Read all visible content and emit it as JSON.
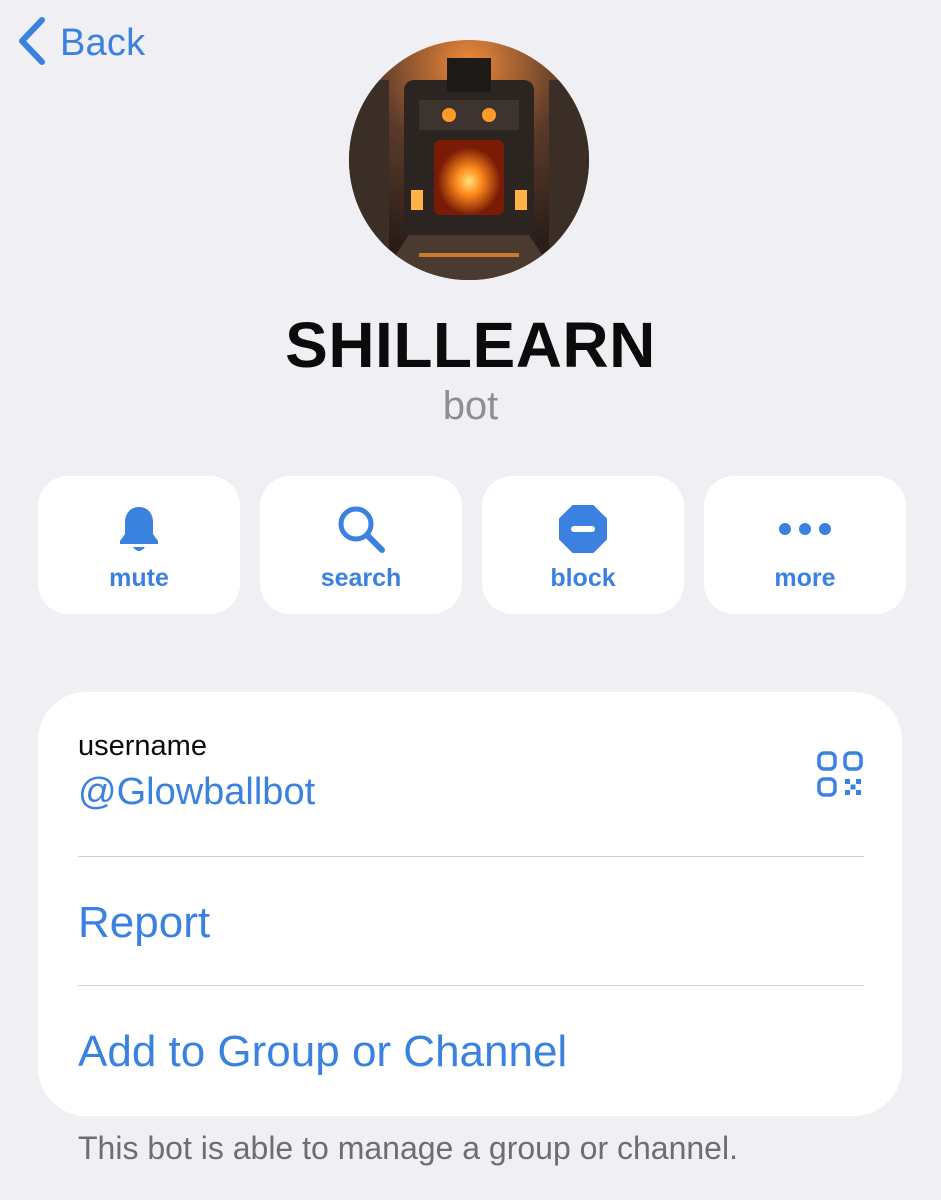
{
  "nav": {
    "back_label": "Back"
  },
  "profile": {
    "name": "SHILLEARN",
    "subtitle": "bot",
    "avatar_icon": "furnace-avatar-image"
  },
  "actions": [
    {
      "label": "mute",
      "icon": "bell-icon"
    },
    {
      "label": "search",
      "icon": "magnifier-icon"
    },
    {
      "label": "block",
      "icon": "block-icon"
    },
    {
      "label": "more",
      "icon": "ellipsis-icon"
    }
  ],
  "info": {
    "username_label": "username",
    "username_value": "@Glowballbot",
    "qr_icon": "qr-code-icon",
    "report_label": "Report",
    "add_label": "Add to Group or Channel"
  },
  "footer_text": "This bot is able to manage a group or channel.",
  "colors": {
    "accent": "#3b82e0",
    "background": "#efeff4",
    "card": "#ffffff",
    "secondary_text": "#8e8e93"
  }
}
